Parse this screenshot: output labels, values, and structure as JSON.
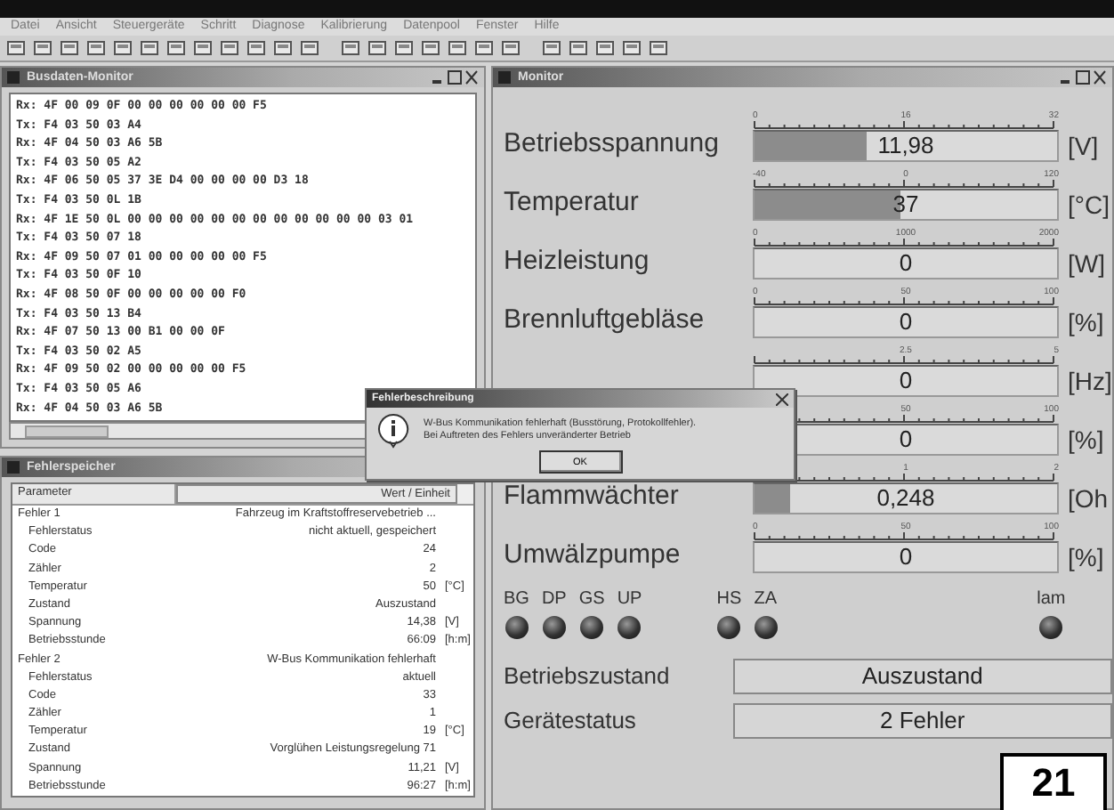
{
  "menu": [
    "Datei",
    "Ansicht",
    "Steuergeräte",
    "Schritt",
    "Diagnose",
    "Kalibrierung",
    "Datenpool",
    "Fenster",
    "Hilfe"
  ],
  "bus_window": {
    "title": "Busdaten-Monitor",
    "lines": [
      "Rx: 4F 00 09 0F 00 00 00 00 00 00 F5",
      "Tx: F4 03 50 03 A4",
      "Rx: 4F 04 50 03 A6 5B",
      "Tx: F4 03 50 05 A2",
      "Rx: 4F 06 50 05 37 3E D4 00 00 00 00 D3 18",
      "Tx: F4 03 50 0L 1B",
      "Rx: 4F 1E 50 0L 00 00 00 00 00 00 00 00 00 00 00 00 03 01",
      "Tx: F4 03 50 07 18",
      "Rx: 4F 09 50 07 01 00 00 00 00 00 F5",
      "Tx: F4 03 50 0F 10",
      "Rx: 4F 08 50 0F 00 00 00 00 00 F0",
      "Tx: F4 03 50 13 B4",
      "Rx: 4F 07 50 13 00 B1 00 00 0F",
      "Tx: F4 03 50 02 A5",
      "Rx: 4F 09 50 02 00 00 00 00 00 F5",
      "Tx: F4 03 50 05 A6",
      "Rx: 4F 04 50 03 A6 5B"
    ]
  },
  "error_window": {
    "title": "Fehlerspeicher",
    "columns": [
      "Parameter",
      "Wert / Einheit"
    ],
    "rows": [
      {
        "kind": "group",
        "param": "Fehler 1",
        "value": "Fahrzeug im Kraftstoffreservebetrieb ..."
      },
      {
        "kind": "item",
        "param": "Fehlerstatus",
        "value": "nicht aktuell, gespeichert"
      },
      {
        "kind": "item",
        "param": "Code",
        "value": "24"
      },
      {
        "kind": "item",
        "param": "Zähler",
        "value": "2"
      },
      {
        "kind": "item",
        "param": "Temperatur",
        "value": "50",
        "unit": "[°C]"
      },
      {
        "kind": "item",
        "param": "Zustand",
        "value": "Auszustand"
      },
      {
        "kind": "item",
        "param": "Spannung",
        "value": "14,38",
        "unit": "[V]"
      },
      {
        "kind": "item",
        "param": "Betriebsstunde",
        "value": "66:09",
        "unit": "[h:m]"
      },
      {
        "kind": "group",
        "param": "Fehler 2",
        "value": "W-Bus Kommunikation fehlerhaft"
      },
      {
        "kind": "item",
        "param": "Fehlerstatus",
        "value": "aktuell"
      },
      {
        "kind": "item",
        "param": "Code",
        "value": "33"
      },
      {
        "kind": "item",
        "param": "Zähler",
        "value": "1"
      },
      {
        "kind": "item",
        "param": "Temperatur",
        "value": "19",
        "unit": "[°C]"
      },
      {
        "kind": "item",
        "param": "Zustand",
        "value": "Vorglühen Leistungsregelung 71"
      },
      {
        "kind": "item",
        "param": "Spannung",
        "value": "11,21",
        "unit": "[V]"
      },
      {
        "kind": "item",
        "param": "Betriebsstunde",
        "value": "96:27",
        "unit": "[h:m]"
      }
    ]
  },
  "monitor_window": {
    "title": "Monitor",
    "gauges": [
      {
        "label": "Betriebsspannung",
        "scale": {
          "min": "0",
          "mid": "16",
          "max": "32"
        },
        "level": 0.37,
        "reading": "11,98",
        "unit": "[V]"
      },
      {
        "label": "Temperatur",
        "scale": {
          "min": "-40",
          "mid": "0",
          "max": "120"
        },
        "level": 0.48,
        "reading": "37",
        "unit": "[°C]"
      },
      {
        "label": "Heizleistung",
        "scale": {
          "min": "0",
          "mid": "1000",
          "max": "2000"
        },
        "level": 0,
        "reading": "0",
        "unit": "[W]"
      },
      {
        "label": "Brennluftgebläse",
        "scale": {
          "min": "0",
          "mid": "50",
          "max": "100"
        },
        "level": 0,
        "reading": "0",
        "unit": "[%]"
      },
      {
        "scale": {
          "mid": "2.5",
          "max": "5"
        },
        "level": 0,
        "reading": "0",
        "unit": "[Hz]"
      },
      {
        "scale": {
          "mid": "50",
          "max": "100"
        },
        "level": 0,
        "reading": "0",
        "unit": "[%]"
      },
      {
        "label": "Flammwächter",
        "scale": {
          "mid": "1",
          "max": "2"
        },
        "level": 0.12,
        "reading": "0,248",
        "unit": "[Oh"
      },
      {
        "label": "Umwälzpumpe",
        "scale": {
          "min": "0",
          "mid": "50",
          "max": "100"
        },
        "level": 0,
        "reading": "0",
        "unit": "[%]"
      }
    ],
    "led_groups": [
      [
        {
          "label": "BG",
          "on": false
        },
        {
          "label": "DP",
          "on": false
        },
        {
          "label": "GS",
          "on": false
        },
        {
          "label": "UP",
          "on": false
        }
      ],
      [
        {
          "label": "HS",
          "on": false
        },
        {
          "label": "ZA",
          "on": false
        }
      ],
      [
        {
          "label": "lam",
          "on": false
        }
      ]
    ],
    "status": [
      {
        "label": "Betriebszustand",
        "value": "Auszustand"
      },
      {
        "label": "Gerätestatus",
        "value": "2 Fehler"
      }
    ]
  },
  "dialog": {
    "title": "Fehlerbeschreibung",
    "message": "W-Bus Kommunikation fehlerhaft (Busstörung, Protokollfehler).\nBei Auftreten des Fehlers unveränderter Betrieb",
    "button": "OK"
  },
  "figure_number": "21"
}
